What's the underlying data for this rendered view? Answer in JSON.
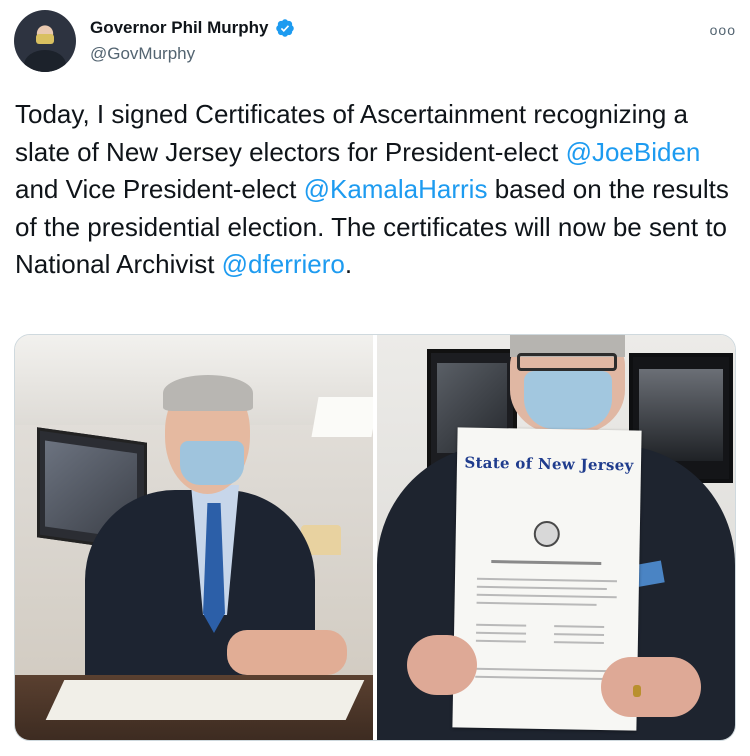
{
  "author": {
    "display_name": "Governor Phil Murphy",
    "handle": "@GovMurphy",
    "verified_icon": "verified-badge-icon",
    "avatar_icon": "avatar"
  },
  "menu": {
    "icon": "more-options-icon",
    "glyph": "ooo"
  },
  "tweet": {
    "segments": [
      {
        "type": "text",
        "value": "Today, I signed Certificates of Ascertainment recognizing a slate of New Jersey electors for President-elect "
      },
      {
        "type": "mention",
        "value": "@JoeBiden"
      },
      {
        "type": "text",
        "value": " and Vice President-elect "
      },
      {
        "type": "mention",
        "value": "@KamalaHarris"
      },
      {
        "type": "text",
        "value": " based on the results of the presidential election. The certificates will now be sent to National Archivist "
      },
      {
        "type": "mention",
        "value": "@dferriero"
      },
      {
        "type": "text",
        "value": "."
      }
    ]
  },
  "media": {
    "photos": [
      {
        "name": "photo-governor-signing"
      },
      {
        "name": "photo-governor-holding-certificate",
        "certificate_title": "State of New Jersey"
      }
    ]
  },
  "colors": {
    "link": "#1d9bf0",
    "text": "#0f1419",
    "secondary": "#536471",
    "verified": "#1d9bf0"
  }
}
